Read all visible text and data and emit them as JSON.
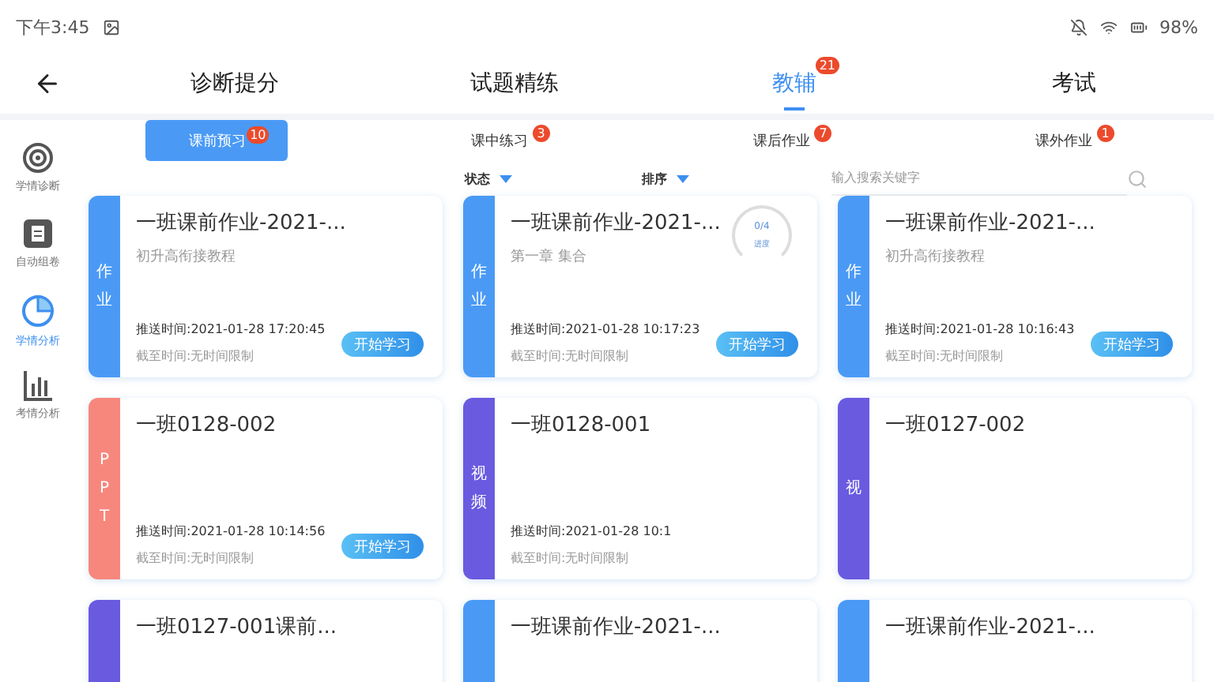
{
  "status_bar": {
    "time": "下午3:45",
    "battery": "98%"
  },
  "top_tabs": [
    {
      "label": "诊断提分",
      "selected": false
    },
    {
      "label": "试题精练",
      "selected": false
    },
    {
      "label": "教辅",
      "selected": true,
      "badge": "21"
    },
    {
      "label": "考试",
      "selected": false
    }
  ],
  "sidebar": {
    "items": [
      {
        "label": "学情诊断",
        "kind": "target",
        "selected": false
      },
      {
        "label": "自动组卷",
        "kind": "paper",
        "selected": false
      },
      {
        "label": "学情分析",
        "kind": "pie",
        "selected": true
      },
      {
        "label": "考情分析",
        "kind": "bars",
        "selected": false
      }
    ]
  },
  "sub_tabs": [
    {
      "label": "课前预习",
      "badge": "10",
      "selected": true
    },
    {
      "label": "课中练习",
      "badge": "3",
      "selected": false
    },
    {
      "label": "课后作业",
      "badge": "7",
      "selected": false
    },
    {
      "label": "课外作业",
      "badge": "1",
      "selected": false
    }
  ],
  "filters": [
    {
      "label": "状态"
    },
    {
      "label": "排序"
    }
  ],
  "search": {
    "placeholder": "输入搜索关键字"
  },
  "cards": [
    {
      "tag": "作业",
      "color": "#4a9af5",
      "title": "一班课前作业-2021-...",
      "subtitle": "初升高衔接教程",
      "push_time": "推送时间:2021-01-28 17:20:45",
      "deadline": "截至时间:无时间限制",
      "button": "开始学习"
    },
    {
      "tag": "作业",
      "color": "#4a9af5",
      "title": "一班课前作业-2021-...",
      "subtitle": "第一章  集合",
      "progress": "0/4",
      "progress_label": "进度",
      "push_time": "推送时间:2021-01-28 10:17:23",
      "deadline": "截至时间:无时间限制",
      "button": "开始学习"
    },
    {
      "tag": "作业",
      "color": "#4a9af5",
      "title": "一班课前作业-2021-...",
      "subtitle": "初升高衔接教程",
      "push_time": "推送时间:2021-01-28 10:16:43",
      "deadline": "截至时间:无时间限制",
      "button": "开始学习"
    },
    {
      "tag": "PPT",
      "color": "#f7877d",
      "title": "一班0128-002",
      "push_time": "推送时间:2021-01-28 10:14:56",
      "deadline": "截至时间:无时间限制",
      "button": "开始学习"
    },
    {
      "tag": "视频",
      "color": "#6a5ae0",
      "title": "一班0128-001",
      "push_time": "推送时间:2021-01-28 10:1",
      "deadline": "截至时间:无时间限制"
    },
    {
      "tag": "视",
      "color": "#6a5ae0",
      "title": "一班0127-002"
    },
    {
      "color": "#6a5ae0",
      "title": "一班0127-001课前..."
    },
    {
      "color": "#4a9af5",
      "title": "一班课前作业-2021-..."
    },
    {
      "color": "#4a9af5",
      "title": "一班课前作业-2021-..."
    }
  ]
}
